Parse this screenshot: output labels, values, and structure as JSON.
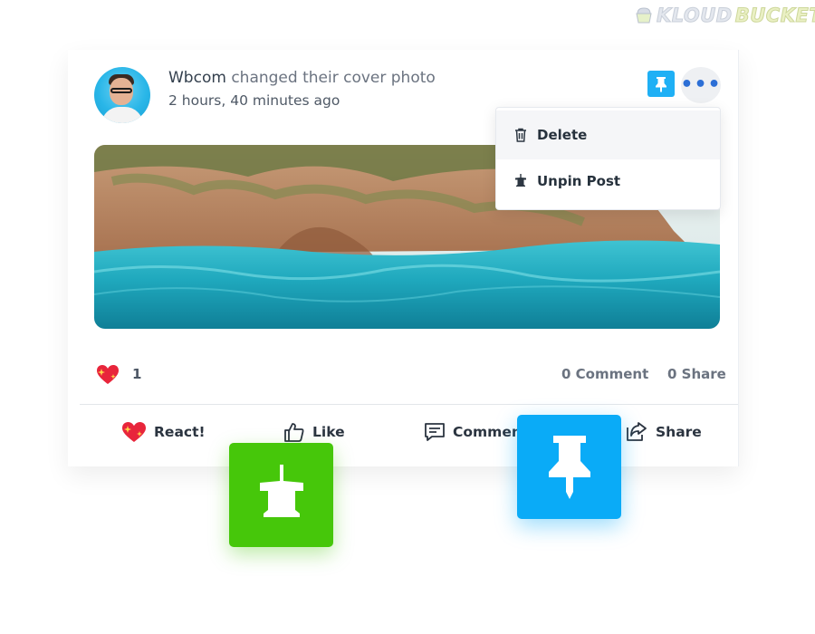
{
  "watermark": {
    "part_a": "KLOUD",
    "part_b": "BUCKET"
  },
  "post": {
    "author": "Wbcom",
    "action_text": "changed their cover photo",
    "timestamp": "2 hours, 40 minutes ago"
  },
  "header_icons": {
    "pin": "pin-icon",
    "more": "more-icon"
  },
  "dropdown": {
    "items": [
      {
        "label": "Delete",
        "icon": "trash-icon"
      },
      {
        "label": "Unpin Post",
        "icon": "unpin-icon"
      }
    ]
  },
  "stats": {
    "reaction_count": "1",
    "comments": "0 Comment",
    "shares": "0 Share"
  },
  "actions": {
    "react": "React!",
    "like": "Like",
    "comment": "Comment",
    "share": "Share"
  },
  "colors": {
    "pin_blue": "#0aabf7",
    "unpin_green": "#46c70a",
    "more_dots": "#2c6fd6",
    "reaction_red": "#e8253b"
  }
}
